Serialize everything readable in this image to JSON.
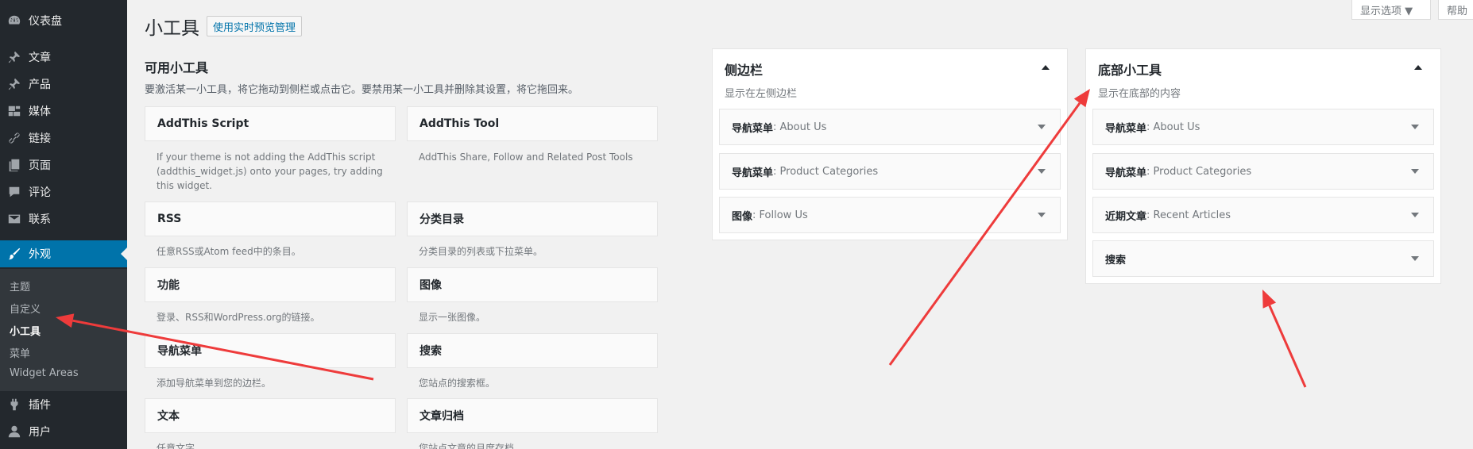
{
  "menu": {
    "items": [
      {
        "label": "仪表盘",
        "icon": "dashboard-icon"
      },
      {
        "label": "文章",
        "icon": "pin-icon"
      },
      {
        "label": "产品",
        "icon": "pin-icon"
      },
      {
        "label": "媒体",
        "icon": "media-icon"
      },
      {
        "label": "链接",
        "icon": "link-icon"
      },
      {
        "label": "页面",
        "icon": "page-icon"
      },
      {
        "label": "评论",
        "icon": "comment-icon"
      },
      {
        "label": "联系",
        "icon": "mail-icon"
      },
      {
        "label": "外观",
        "icon": "appearance-icon"
      },
      {
        "label": "插件",
        "icon": "plugin-icon"
      },
      {
        "label": "用户",
        "icon": "user-icon"
      }
    ],
    "submenu": [
      "主题",
      "自定义",
      "小工具",
      "菜单",
      "Widget Areas"
    ]
  },
  "screen_meta": {
    "screen_options": "显示选项 ▼",
    "help": "帮助"
  },
  "header": {
    "title": "小工具",
    "action": "使用实时预览管理"
  },
  "available": {
    "title": "可用小工具",
    "description": "要激活某一小工具，将它拖动到侧栏或点击它。要禁用某一小工具并删除其设置，将它拖回来。",
    "widgets": [
      {
        "name": "AddThis Script",
        "desc": "If your theme is not adding the AddThis script (addthis_widget.js) onto your pages, try adding this widget."
      },
      {
        "name": "AddThis Tool",
        "desc": "AddThis Share, Follow and Related Post Tools"
      },
      {
        "name": "RSS",
        "desc": "任意RSS或Atom feed中的条目。"
      },
      {
        "name": "分类目录",
        "desc": "分类目录的列表或下拉菜单。"
      },
      {
        "name": "功能",
        "desc": "登录、RSS和WordPress.org的链接。"
      },
      {
        "name": "图像",
        "desc": "显示一张图像。"
      },
      {
        "name": "导航菜单",
        "desc": "添加导航菜单到您的边栏。"
      },
      {
        "name": "搜索",
        "desc": "您站点的搜索框。"
      },
      {
        "name": "文本",
        "desc": "任意文字。"
      },
      {
        "name": "文章归档",
        "desc": "您站点文章的月度存档。"
      }
    ]
  },
  "sidebar_left": {
    "title": "侧边栏",
    "description": "显示在左侧边栏",
    "widgets": [
      {
        "name": "导航菜单",
        "title": ": About Us"
      },
      {
        "name": "导航菜单",
        "title": ": Product Categories"
      },
      {
        "name": "图像",
        "title": ": Follow Us"
      }
    ]
  },
  "sidebar_footer": {
    "title": "底部小工具",
    "description": "显示在底部的内容",
    "widgets": [
      {
        "name": "导航菜单",
        "title": ": About Us"
      },
      {
        "name": "导航菜单",
        "title": ": Product Categories"
      },
      {
        "name": "近期文章",
        "title": ": Recent Articles"
      },
      {
        "name": "搜索",
        "title": ""
      }
    ]
  },
  "annotation_color": "#ee3b3b"
}
